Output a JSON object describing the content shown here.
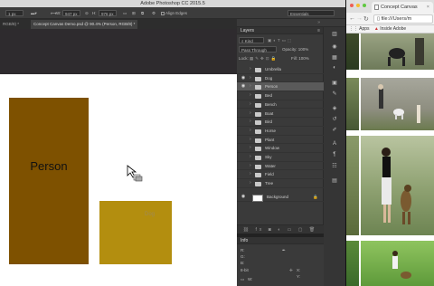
{
  "app_title": "Adobe Photoshop CC 2015.5",
  "options": {
    "size": "1 px",
    "width_label": "W:",
    "width_value": "947 px",
    "height_label": "H:",
    "height_value": "976 px",
    "align_edges": "Align Edges",
    "workspace": "Essentials"
  },
  "doc_tabs": [
    {
      "label": "RGB/8) *"
    },
    {
      "label": "Concept Canvas Demo.psd @ 90.4% (Person, RGB/8) *"
    }
  ],
  "canvas": {
    "person_label": "Person",
    "dog_label": "Dog"
  },
  "layers_panel": {
    "title": "Layers",
    "filter": "Kind",
    "blend_mode": "Pass Through",
    "opacity": "Opacity: 100%",
    "lock": "Lock:",
    "fill": "Fill: 100%",
    "layers": [
      {
        "name": "Umbrella",
        "visible": false,
        "selected": false
      },
      {
        "name": "Dog",
        "visible": true,
        "selected": false
      },
      {
        "name": "Person",
        "visible": true,
        "selected": true
      },
      {
        "name": "Bed",
        "visible": false,
        "selected": false
      },
      {
        "name": "Bench",
        "visible": false,
        "selected": false
      },
      {
        "name": "Boat",
        "visible": false,
        "selected": false
      },
      {
        "name": "Bird",
        "visible": false,
        "selected": false
      },
      {
        "name": "Horse",
        "visible": false,
        "selected": false
      },
      {
        "name": "Plant",
        "visible": false,
        "selected": false
      },
      {
        "name": "Window",
        "visible": false,
        "selected": false
      },
      {
        "name": "Sky",
        "visible": false,
        "selected": false
      },
      {
        "name": "Water",
        "visible": false,
        "selected": false
      },
      {
        "name": "Field",
        "visible": false,
        "selected": false
      },
      {
        "name": "Tree",
        "visible": false,
        "selected": false
      }
    ],
    "background_layer": "Background"
  },
  "info_panel": {
    "title": "Info",
    "r": "R:",
    "g": "G:",
    "b": "B:",
    "bits": "8-bit",
    "x": "X:",
    "y": "Y:",
    "w": "W:",
    "h": "H:"
  },
  "browser": {
    "tab_title": "Concept Canvas",
    "url": "file:///Users/m",
    "bookmark_apps": "Apps",
    "bookmark_inside": "Inside Adobe"
  },
  "colors": {
    "person_fill": "#7e5100",
    "dog_fill": "#b38e0f",
    "selection": "#5a5a5a"
  }
}
